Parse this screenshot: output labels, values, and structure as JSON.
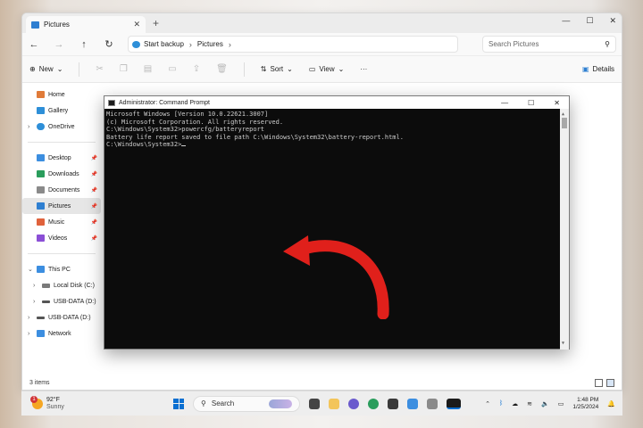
{
  "explorer": {
    "tab_title": "Pictures",
    "tab_close": "✕",
    "new_tab": "+",
    "window_controls": {
      "minimize": "—",
      "maximize": "☐",
      "close": "✕"
    },
    "address": {
      "backup_label": "Start backup",
      "crumb": "Pictures",
      "separator": "›"
    },
    "search_placeholder": "Search Pictures",
    "toolbar": {
      "new_label": "New",
      "sort_label": "Sort",
      "view_label": "View",
      "more_label": "···",
      "details_label": "Details"
    },
    "sidebar": {
      "top": [
        {
          "label": "Home",
          "color": "#e07b39"
        },
        {
          "label": "Gallery",
          "color": "#2e8fd8"
        },
        {
          "label": "OneDrive",
          "color": "#2e8fd8"
        }
      ],
      "quick": [
        {
          "label": "Desktop",
          "color": "#3c8ee0"
        },
        {
          "label": "Downloads",
          "color": "#2a9d5c"
        },
        {
          "label": "Documents",
          "color": "#8a8a8a"
        },
        {
          "label": "Pictures",
          "color": "#2e7fd1"
        },
        {
          "label": "Music",
          "color": "#e0623c"
        },
        {
          "label": "Videos",
          "color": "#8b4fd6"
        }
      ],
      "devices": [
        {
          "label": "This PC",
          "color": "#3c8ee0"
        },
        {
          "label": "Local Disk (C:)",
          "color": "#7a7a7a"
        },
        {
          "label": "USB-DATA (D:)",
          "color": "#555555"
        },
        {
          "label": "USB-DATA (D:)",
          "color": "#555555"
        },
        {
          "label": "Network",
          "color": "#3c8ee0"
        }
      ]
    },
    "status": "3 items"
  },
  "cmd": {
    "title": "Administrator: Command Prompt",
    "controls": {
      "minimize": "—",
      "maximize": "☐",
      "close": "✕"
    },
    "lines": [
      "Microsoft Windows [Version 10.0.22621.3007]",
      "(c) Microsoft Corporation. All rights reserved.",
      "",
      "C:\\Windows\\System32>powercfg/batteryreport",
      "Battery life report saved to file path C:\\Windows\\System32\\battery-report.html.",
      "",
      "C:\\Windows\\System32>"
    ],
    "arrow_color": "#e0201b"
  },
  "taskbar": {
    "weather_temp": "92°F",
    "weather_desc": "Sunny",
    "weather_badge": "1",
    "search_label": "Search",
    "time": "1:48 PM",
    "date": "1/25/2024"
  }
}
